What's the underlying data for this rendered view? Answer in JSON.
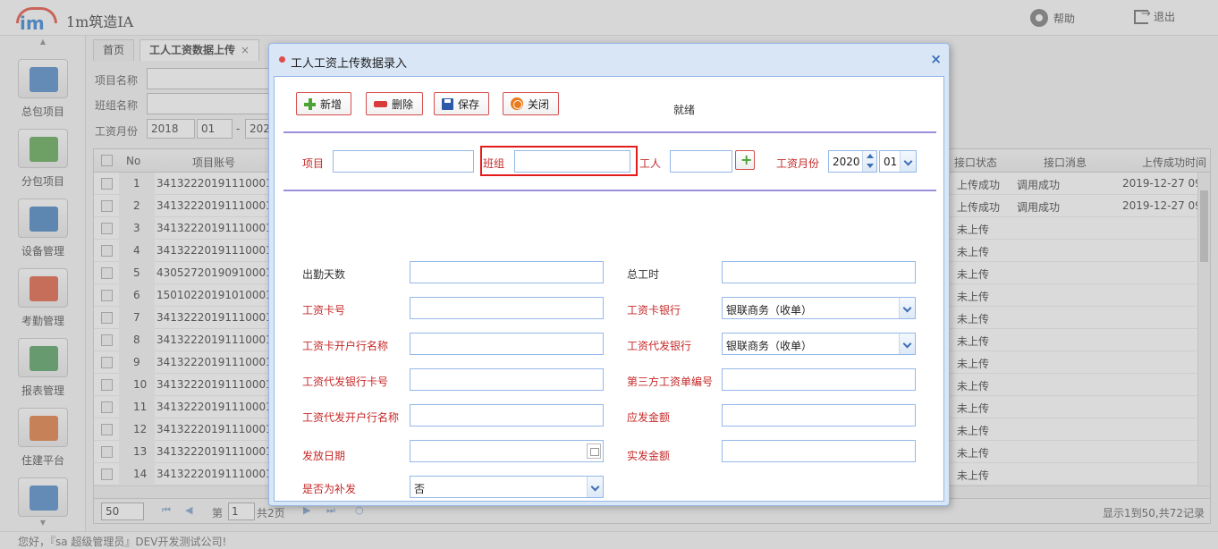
{
  "app": {
    "title": "1m筑造IA",
    "logo_text": "im",
    "help_label": "帮助",
    "exit_label": "退出"
  },
  "sidebar": {
    "items": [
      {
        "label": "总包项目",
        "icon": "project-icon",
        "color": "#4a86c8"
      },
      {
        "label": "分包项目",
        "icon": "subproject-icon",
        "color": "#5aa64e"
      },
      {
        "label": "设备管理",
        "icon": "device-icon",
        "color": "#3f7fbf"
      },
      {
        "label": "考勤管理",
        "icon": "calendar-icon",
        "color": "#e05a3a"
      },
      {
        "label": "报表管理",
        "icon": "report-icon",
        "color": "#4f9d5a"
      },
      {
        "label": "住建平台",
        "icon": "platform-icon",
        "color": "#e0773a"
      },
      {
        "label": "",
        "icon": "settings-icon",
        "color": "#4a86c8"
      }
    ]
  },
  "tabs": [
    {
      "label": "首页"
    },
    {
      "label": "工人工资数据上传",
      "close": "×"
    }
  ],
  "filters": {
    "project_label": "项目名称",
    "team_label": "班组名称",
    "month_label": "工资月份",
    "year": "2018",
    "month": "01",
    "dash": "-",
    "year_end": "202"
  },
  "grid": {
    "headers": {
      "no": "No",
      "account": "项目账号",
      "api_status": "接口状态",
      "api_msg": "接口消息",
      "upload_time": "上传成功时间"
    },
    "rows": [
      {
        "no": "1",
        "account": "34132220191110001",
        "status": "上传成功",
        "msg": "调用成功",
        "time": "2019-12-27 09"
      },
      {
        "no": "2",
        "account": "34132220191110001",
        "status": "上传成功",
        "msg": "调用成功",
        "time": "2019-12-27 09"
      },
      {
        "no": "3",
        "account": "34132220191110001",
        "status": "未上传",
        "msg": "",
        "time": ""
      },
      {
        "no": "4",
        "account": "34132220191110001",
        "status": "未上传",
        "msg": "",
        "time": ""
      },
      {
        "no": "5",
        "account": "43052720190910001",
        "status": "未上传",
        "msg": "",
        "time": ""
      },
      {
        "no": "6",
        "account": "15010220191010001",
        "status": "未上传",
        "msg": "",
        "time": ""
      },
      {
        "no": "7",
        "account": "34132220191110001",
        "status": "未上传",
        "msg": "",
        "time": ""
      },
      {
        "no": "8",
        "account": "34132220191110001",
        "status": "未上传",
        "msg": "",
        "time": ""
      },
      {
        "no": "9",
        "account": "34132220191110001",
        "status": "未上传",
        "msg": "",
        "time": ""
      },
      {
        "no": "10",
        "account": "34132220191110001",
        "status": "未上传",
        "msg": "",
        "time": ""
      },
      {
        "no": "11",
        "account": "34132220191110001",
        "status": "未上传",
        "msg": "",
        "time": ""
      },
      {
        "no": "12",
        "account": "34132220191110001",
        "status": "未上传",
        "msg": "",
        "time": ""
      },
      {
        "no": "13",
        "account": "34132220191110001",
        "status": "未上传",
        "msg": "",
        "time": ""
      },
      {
        "no": "14",
        "account": "34132220191110001",
        "status": "未上传",
        "msg": "",
        "time": ""
      }
    ]
  },
  "pager": {
    "page_size": "50",
    "page_prefix": "第",
    "page": "1",
    "page_suffix": "共2页",
    "info": "显示1到50,共72记录"
  },
  "status_bar": "您好，『sa 超级管理员』DEV开发测试公司!",
  "modal": {
    "title": "工人工资上传数据录入",
    "close": "×",
    "toolbar": {
      "add": "新增",
      "delete": "删除",
      "save": "保存",
      "close": "关闭"
    },
    "status": "就绪",
    "search": {
      "project_label": "项目",
      "team_label": "班组",
      "worker_label": "工人",
      "month_label": "工资月份",
      "year": "2020",
      "month": "01"
    },
    "form": {
      "attendance_days": "出勤天数",
      "total_hours": "总工时",
      "card_no": "工资卡号",
      "card_bank": "工资卡银行",
      "card_bank_value": "银联商务（收单）",
      "card_account_name": "工资卡开户行名称",
      "agent_bank": "工资代发银行",
      "agent_bank_value": "银联商务（收单）",
      "agent_card_no": "工资代发银行卡号",
      "third_party_no": "第三方工资单编号",
      "agent_account_name": "工资代发开户行名称",
      "payable_amount": "应发金额",
      "pay_date": "发放日期",
      "actual_amount": "实发金额",
      "is_supplement": "是否为补发",
      "is_supplement_value": "否"
    }
  },
  "colors": {
    "accent": "#95b8e7",
    "required": "#c62828",
    "highlight": "#e21b1b",
    "divider": "#9d8fdc"
  }
}
